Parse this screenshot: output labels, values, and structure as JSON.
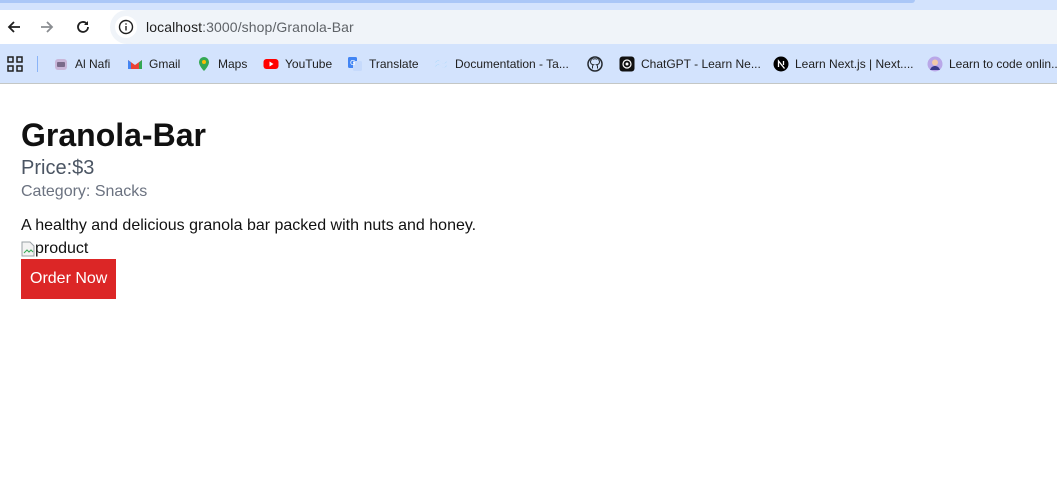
{
  "browser": {
    "url_host": "localhost",
    "url_path": ":3000/shop/Granola-Bar",
    "bookmarks": [
      {
        "label": "Al Nafi",
        "icon": "al-nafi-icon"
      },
      {
        "label": "Gmail",
        "icon": "gmail-icon"
      },
      {
        "label": "Maps",
        "icon": "maps-icon"
      },
      {
        "label": "YouTube",
        "icon": "youtube-icon"
      },
      {
        "label": "Translate",
        "icon": "translate-icon"
      },
      {
        "label": "Documentation - Ta...",
        "icon": "tailwind-icon"
      },
      {
        "label": "",
        "icon": "github-icon"
      },
      {
        "label": "ChatGPT - Learn Ne...",
        "icon": "chatgpt-icon"
      },
      {
        "label": "Learn Next.js | Next....",
        "icon": "nextjs-icon"
      },
      {
        "label": "Learn to code onlin...",
        "icon": "avatar-icon"
      }
    ]
  },
  "product": {
    "title": "Granola-Bar",
    "price": "Price:$3",
    "category": "Category: Snacks",
    "description": "A healthy and delicious granola bar packed with nuts and honey.",
    "image_alt": "product",
    "order_label": "Order Now",
    "order_color": "#dc2626"
  }
}
